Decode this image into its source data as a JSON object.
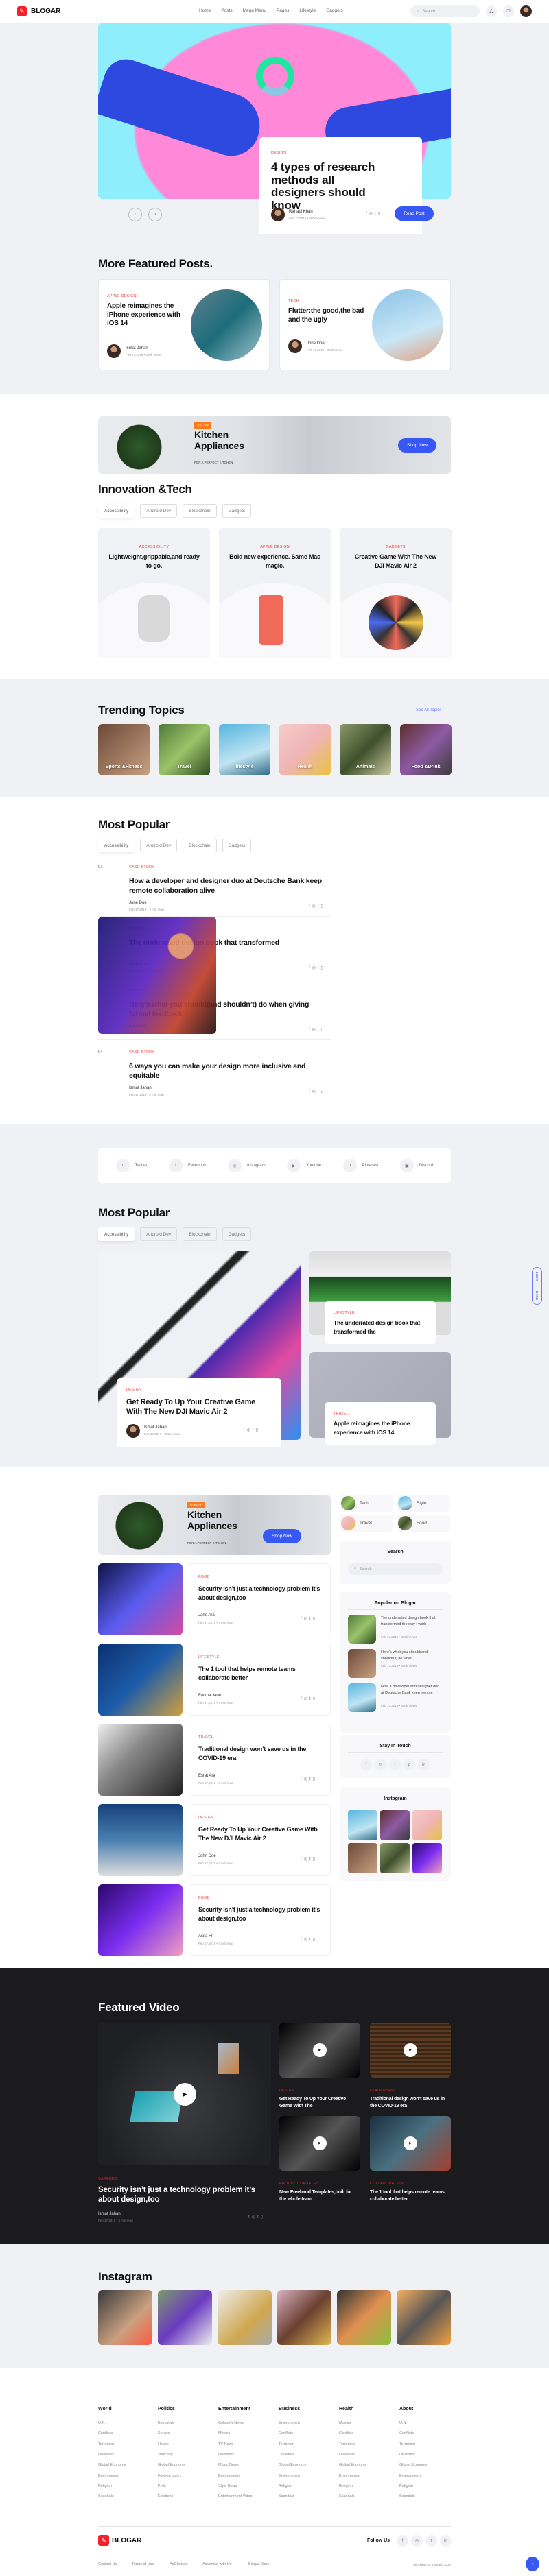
{
  "header": {
    "logo": "BLOGAR",
    "nav": [
      "Home",
      "Posts",
      "Mega Menu",
      "Pages",
      "Lifestyle",
      "Gadgets"
    ],
    "search_placeholder": "Search"
  },
  "hero": {
    "category": "DESIGN",
    "title": "4 types of research methods all designers should know",
    "author": "Rahabi Khan",
    "date": "Feb 17,2019",
    "views": "300k Views",
    "button": "Read Post"
  },
  "featured": {
    "title": "More Featured Posts.",
    "posts": [
      {
        "category": "APPLE DESIGN",
        "title": "Apple reimagines the iPhone experience with iOS 14",
        "author": "Ismat Jahan",
        "date": "Feb 17,2019",
        "views": "300k Views"
      },
      {
        "category": "TECH",
        "title": "Flutter:the good,the bad and the ugly",
        "author": "Jone Doe",
        "date": "Feb 17,2019",
        "views": "300k Views"
      }
    ]
  },
  "banner": {
    "badge": "60% OFF",
    "title": "Kitchen Appliances",
    "subtitle": "FOR A PERFECT KITCHEN.",
    "button": "Shop Now"
  },
  "innovation": {
    "title": "Innovation &Tech",
    "tabs": [
      "Accessibility",
      "Android Dev",
      "Blockchain",
      "Gadgets"
    ],
    "cards": [
      {
        "category": "ACCESSIBILITY",
        "title": "Lightweight,grippable,and ready to go."
      },
      {
        "category": "APPLE DESIGN",
        "title": "Bold new experience. Same Mac magic."
      },
      {
        "category": "GADGETS",
        "title": "Creative Game With The New DJI Mavic Air 2"
      }
    ]
  },
  "trending": {
    "title": "Trending Topics",
    "see_all": "See All Topics",
    "topics": [
      "Sports &Fitness",
      "Travel",
      "lifestyle",
      "Health",
      "Animals",
      "Food &Drink"
    ]
  },
  "popular_list": {
    "title": "Most Popular",
    "tabs": [
      "Accessibility",
      "Android Dev",
      "Blockchain",
      "Gadgets"
    ],
    "items": [
      {
        "num": "01",
        "category": "CASE STUDY",
        "title": "How a developer and designer duo at Deutsche Bank keep remote collaboration alive",
        "author": "Jone Doe",
        "date": "Feb 17,2019",
        "read": "3 min read"
      },
      {
        "num": "02",
        "category": "BOOKS",
        "title": "The underrated design book that transformed",
        "author": "Jane Afroj",
        "date": "Feb 17,2019",
        "read": "3 min read"
      },
      {
        "num": "03",
        "category": "PROCESS",
        "title": "Here’s what you should(and shouldn’t) do when giving formal feedback",
        "author": "Esrat Ara",
        "date": "Feb 17,2019",
        "read": "3 min read"
      },
      {
        "num": "04",
        "category": "CASE STUDY",
        "title": "6 ways you can make your design more inclusive and equitable",
        "author": "Ismat Jahan",
        "date": "Feb 17,2019",
        "read": "3 min read"
      }
    ]
  },
  "social": [
    {
      "label": "Twitter",
      "icon": "twitter-icon",
      "glyph": "t"
    },
    {
      "label": "Facebook",
      "icon": "facebook-icon",
      "glyph": "f"
    },
    {
      "label": "Instagram",
      "icon": "instagram-icon",
      "glyph": "◎"
    },
    {
      "label": "Youtube",
      "icon": "youtube-icon",
      "glyph": "▶"
    },
    {
      "label": "Pinterest",
      "icon": "pinterest-icon",
      "glyph": "p"
    },
    {
      "label": "Discord",
      "icon": "discord-icon",
      "glyph": "▣"
    }
  ],
  "popular_grid": {
    "title": "Most Popular",
    "tabs": [
      "Accessibility",
      "Android Dev",
      "Blockchain",
      "Gadgets"
    ],
    "main": {
      "category": "DESIGN",
      "title": "Get Ready To Up Your Creative Game With The New DJI Mavic Air 2",
      "author": "Ismat Jahan",
      "date": "Feb 17,2019",
      "views": "300k Views"
    },
    "side": [
      {
        "category": "LIFESTYLE",
        "title": "The underrated design book that transformed the"
      },
      {
        "category": "TRAVEL",
        "title": "Apple reimagines the iPhone experience with iOS 14"
      }
    ]
  },
  "theme_toggle": [
    "LIGHT",
    "DARK"
  ],
  "post_list": [
    {
      "category": "FOOD",
      "title": "Security isn’t just a technology problem it’s about design,too",
      "author": "Jane Ara",
      "date": "Feb 17,2019",
      "read": "3 min read"
    },
    {
      "category": "LIFESTYLE",
      "title": "The 1 tool that helps remote teams collaborate better",
      "author": "Fatima Jane",
      "date": "Feb 17,2019",
      "read": "3 min read"
    },
    {
      "category": "TRAVEL",
      "title": "Traditional design won’t save us in the COVID-19 era",
      "author": "Esrat Ara",
      "date": "Feb 17,2019",
      "read": "3 min read"
    },
    {
      "category": "DESIGN",
      "title": "Get Ready To Up Your Creative Game With The New DJI Mavic Air 2",
      "author": "John Doe",
      "date": "Feb 17,2019",
      "read": "3 min read"
    },
    {
      "category": "FOOD",
      "title": "Security isn’t just a technology problem it’s about design,too",
      "author": "Asifa Fr",
      "date": "Feb 17,2019",
      "read": "3 min read"
    }
  ],
  "sidebar": {
    "categories": [
      "Tech",
      "Style",
      "Travel",
      "Food"
    ],
    "search_title": "Search",
    "search_placeholder": "Search",
    "popular_title": "Popular on Blogar",
    "popular": [
      {
        "title": "The underrated design book that transformed the way I work",
        "date": "Feb 17,2019",
        "views": "300k Views"
      },
      {
        "title": "Here’s what you should(and shouldn’t) do when",
        "date": "Feb 17,2019",
        "views": "300k Views"
      },
      {
        "title": "How a developer and designer duo at Deutsche Bank keep remote",
        "date": "Feb 17,2019",
        "views": "300k Views"
      }
    ],
    "stay_title": "Stay In Touch",
    "instagram_title": "Instagram"
  },
  "video": {
    "title": "Featured Video",
    "main": {
      "category": "CAREERS",
      "title": "Security isn’t just a technology problem it’s about design,too",
      "author": "Ismat Jahan",
      "date": "Feb 17,2019",
      "read": "3 min read"
    },
    "items": [
      {
        "category": "DESIGN",
        "title": "Get Ready To Up Your Creative Game With The"
      },
      {
        "category": "LEADERSHIP",
        "title": "Traditional design won’t save us in the COVID-19 era"
      },
      {
        "category": "PRODUCT UPDATES",
        "title": "New:Freehand Templates,built for the whole team"
      },
      {
        "category": "COLLABORATION",
        "title": "The 1 tool that helps remote teams collaborate better"
      }
    ]
  },
  "instagram": {
    "title": "Instagram"
  },
  "footer": {
    "columns": [
      {
        "heading": "World",
        "links": [
          "U.N.",
          "Conflicts",
          "Terrorism",
          "Disasters",
          "Global Economy",
          "Environment",
          "Religion",
          "Scandals"
        ]
      },
      {
        "heading": "Politics",
        "links": [
          "Executive",
          "Senate",
          "House",
          "Judiciary",
          "Global Economy",
          "Foreign policy",
          "Polls",
          "Elections"
        ]
      },
      {
        "heading": "Entertainment",
        "links": [
          "Celebrity News",
          "Movies",
          "TV News",
          "Disasters",
          "Music News",
          "Environment",
          "Style News",
          "Entertainment Video"
        ]
      },
      {
        "heading": "Business",
        "links": [
          "Environment",
          "Conflicts",
          "Terrorism",
          "Disasters",
          "Global Economy",
          "Environment",
          "Religion",
          "Scandals"
        ]
      },
      {
        "heading": "Health",
        "links": [
          "Movies",
          "Conflicts",
          "Terrorism",
          "Disasters",
          "Global Economy",
          "Environment",
          "Religion",
          "Scandals"
        ]
      },
      {
        "heading": "About",
        "links": [
          "U.N.",
          "Conflicts",
          "Terrorism",
          "Disasters",
          "Global Economy",
          "Environment",
          "Religion",
          "Scandals"
        ]
      }
    ],
    "logo": "BLOGAR",
    "follow": "Follow Us",
    "bottom_links": [
      "Contact Us",
      "Terms of Use",
      "AdChoices",
      "Advertise with Us",
      "Blogar Store"
    ],
    "copyright": "All Rights By Thucai© 2020"
  },
  "colors": {
    "accent": "#3858f6",
    "category": "#e94a4a",
    "dark_bg": "#1b1b1d",
    "page_bg": "#f0f1f5"
  }
}
